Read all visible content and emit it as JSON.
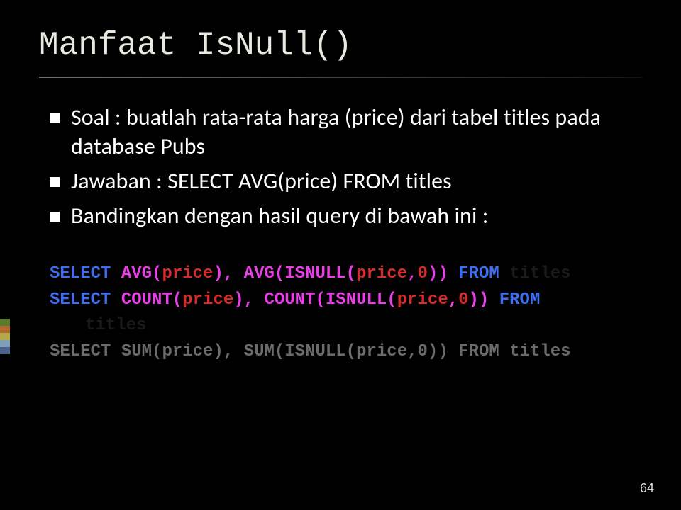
{
  "title": "Manfaat IsNull()",
  "bullets": [
    "Soal : buatlah rata-rata harga (price) dari tabel titles pada database Pubs",
    "Jawaban : SELECT AVG(price) FROM titles",
    "Bandingkan dengan hasil query di bawah ini :"
  ],
  "code": {
    "line1": {
      "kw1": "SELECT ",
      "f1": "AVG(",
      "s1": "price",
      "f2": "), AVG(ISNULL(",
      "s2": "price",
      "f3": ",",
      "s3": "0",
      "f4": ")) ",
      "kw2": "FROM ",
      "t": " titles"
    },
    "line2a": {
      "kw1": "SELECT ",
      "f1": "COUNT(",
      "s1": "price",
      "f2": "), COUNT(ISNULL(",
      "s2": "price",
      "f3": ",",
      "s3": "0",
      "f4": ")) ",
      "kw2": "FROM "
    },
    "line2b": {
      "t": "titles"
    },
    "line3": {
      "kw1": "SELECT ",
      "f1": "SUM(",
      "s1": "price",
      "f2": "), SUM(ISNULL(",
      "s2": "price",
      "f3": ",",
      "s3": "0",
      "f4": ")) ",
      "kw2": "FROM ",
      "t": " titles"
    }
  },
  "pagenum": "64"
}
